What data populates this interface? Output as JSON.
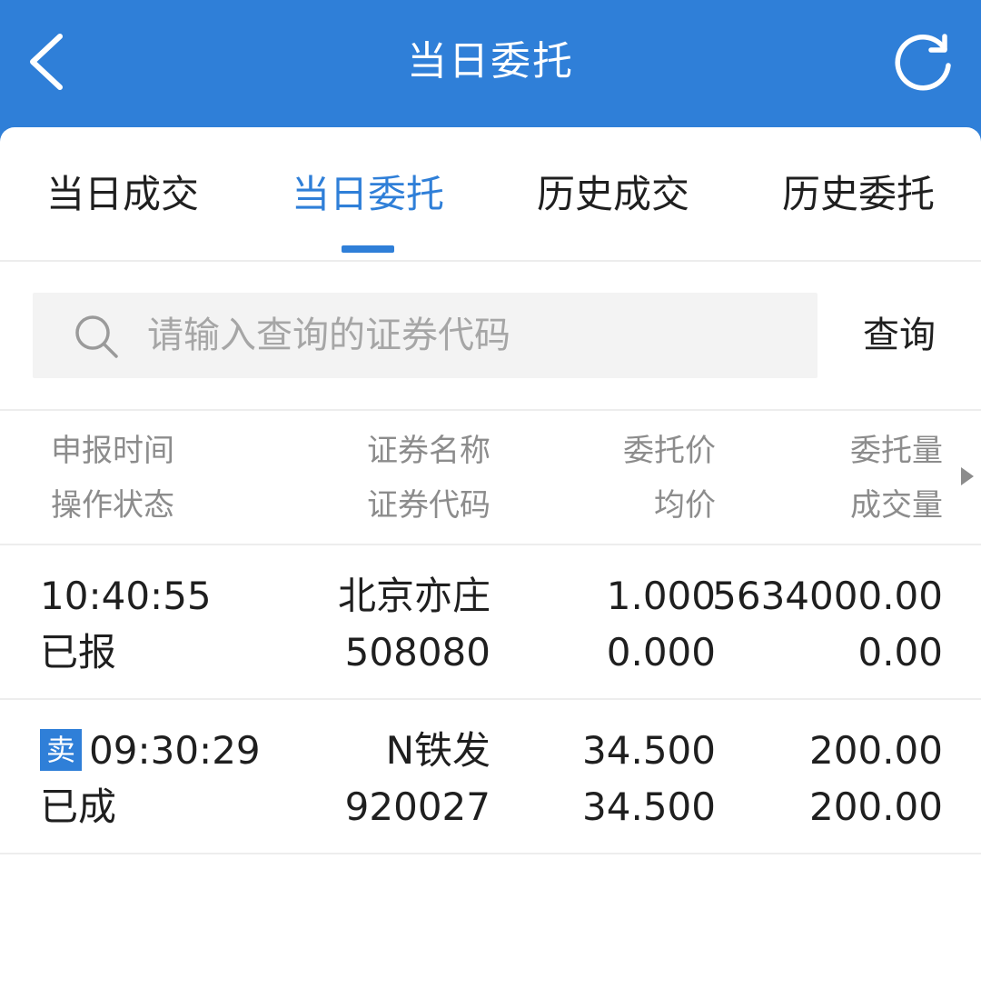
{
  "header": {
    "title": "当日委托",
    "back_icon": "chevron-left-icon",
    "refresh_icon": "refresh-icon"
  },
  "tabs": [
    {
      "label": "当日成交",
      "active": false
    },
    {
      "label": "当日委托",
      "active": true
    },
    {
      "label": "历史成交",
      "active": false
    },
    {
      "label": "历史委托",
      "active": false
    }
  ],
  "search": {
    "placeholder": "请输入查询的证券代码",
    "value": "",
    "button_label": "查询"
  },
  "table": {
    "headers": {
      "col1_top": "申报时间",
      "col1_bottom": "操作状态",
      "col2_top": "证券名称",
      "col2_bottom": "证券代码",
      "col3_top": "委托价",
      "col3_bottom": "均价",
      "col4_top": "委托量",
      "col4_bottom": "成交量"
    },
    "rows": [
      {
        "side": "",
        "time": "10:40:55",
        "status": "已报",
        "name": "北京亦庄",
        "code": "508080",
        "price": "1.000",
        "avg_price": "0.000",
        "qty": "5634000.00",
        "filled_qty": "0.00"
      },
      {
        "side": "卖",
        "time": "09:30:29",
        "status": "已成",
        "name": "N铁发",
        "code": "920027",
        "price": "34.500",
        "avg_price": "34.500",
        "qty": "200.00",
        "filled_qty": "200.00"
      }
    ]
  },
  "colors": {
    "accent": "#2f7fd8",
    "text": "#1f1f1f",
    "muted": "#8c8c8c",
    "divider": "#ededed"
  }
}
